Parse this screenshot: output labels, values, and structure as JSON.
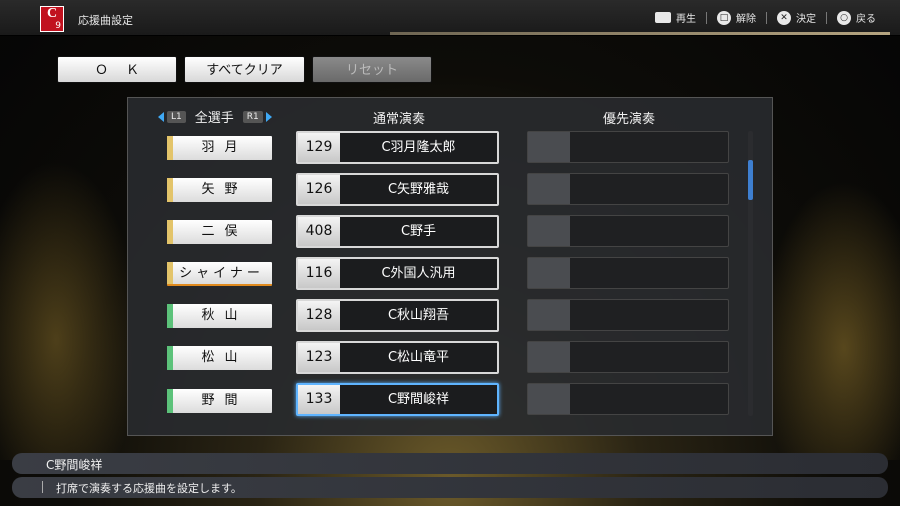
{
  "header": {
    "team_logo_letter": "C",
    "team_logo_number": "9",
    "title": "応援曲設定",
    "hints": [
      {
        "icon": "touchpad-icon",
        "label": "再生"
      },
      {
        "icon": "square-button-icon",
        "label": "解除"
      },
      {
        "icon": "cross-button-icon",
        "label": "決定"
      },
      {
        "icon": "circle-button-icon",
        "label": "戻る"
      }
    ]
  },
  "actions": {
    "ok_label": "ＯＫ",
    "clear_label": "すべてクリア",
    "reset_label": "リセット"
  },
  "list": {
    "filter_left": "L1",
    "filter_label": "全選手",
    "filter_right": "R1",
    "col_normal": "通常演奏",
    "col_priority": "優先演奏",
    "rows": [
      {
        "player": "羽月",
        "bar_color": "#e3c46a",
        "song_no": "129",
        "song": "C羽月隆太郎"
      },
      {
        "player": "矢野",
        "bar_color": "#e3c46a",
        "song_no": "126",
        "song": "C矢野雅哉"
      },
      {
        "player": "二俣",
        "bar_color": "#e3c46a",
        "song_no": "408",
        "song": "C野手"
      },
      {
        "player": "シャイナー",
        "bar_color": "#e3c46a",
        "song_no": "116",
        "song": "C外国人汎用"
      },
      {
        "player": "秋山",
        "bar_color": "#5cc27a",
        "song_no": "128",
        "song": "C秋山翔吾"
      },
      {
        "player": "松山",
        "bar_color": "#5cc27a",
        "song_no": "123",
        "song": "C松山竜平"
      },
      {
        "player": "野間",
        "bar_color": "#5cc27a",
        "song_no": "133",
        "song": "C野間峻祥"
      }
    ]
  },
  "footer": {
    "selected": "C野間峻祥",
    "description": "打席で演奏する応援曲を設定します。"
  }
}
